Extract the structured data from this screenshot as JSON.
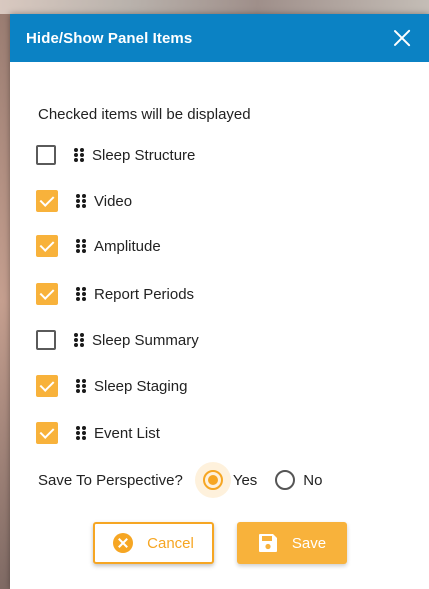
{
  "dialog": {
    "title": "Hide/Show Panel Items",
    "instructions": "Checked items will be displayed",
    "items": [
      {
        "label": "Sleep Structure",
        "checked": false
      },
      {
        "label": "Video",
        "checked": true
      },
      {
        "label": "Amplitude",
        "checked": true
      },
      {
        "label": "Report Periods",
        "checked": true
      },
      {
        "label": "Sleep Summary",
        "checked": false
      },
      {
        "label": "Sleep Staging",
        "checked": true
      },
      {
        "label": "Event List",
        "checked": true
      }
    ],
    "perspective": {
      "label": "Save To Perspective?",
      "options": [
        "Yes",
        "No"
      ],
      "selected": "Yes"
    },
    "buttons": {
      "cancel": "Cancel",
      "save": "Save"
    },
    "colors": {
      "header": "#0b82c4",
      "accent": "#f8b23b"
    }
  }
}
